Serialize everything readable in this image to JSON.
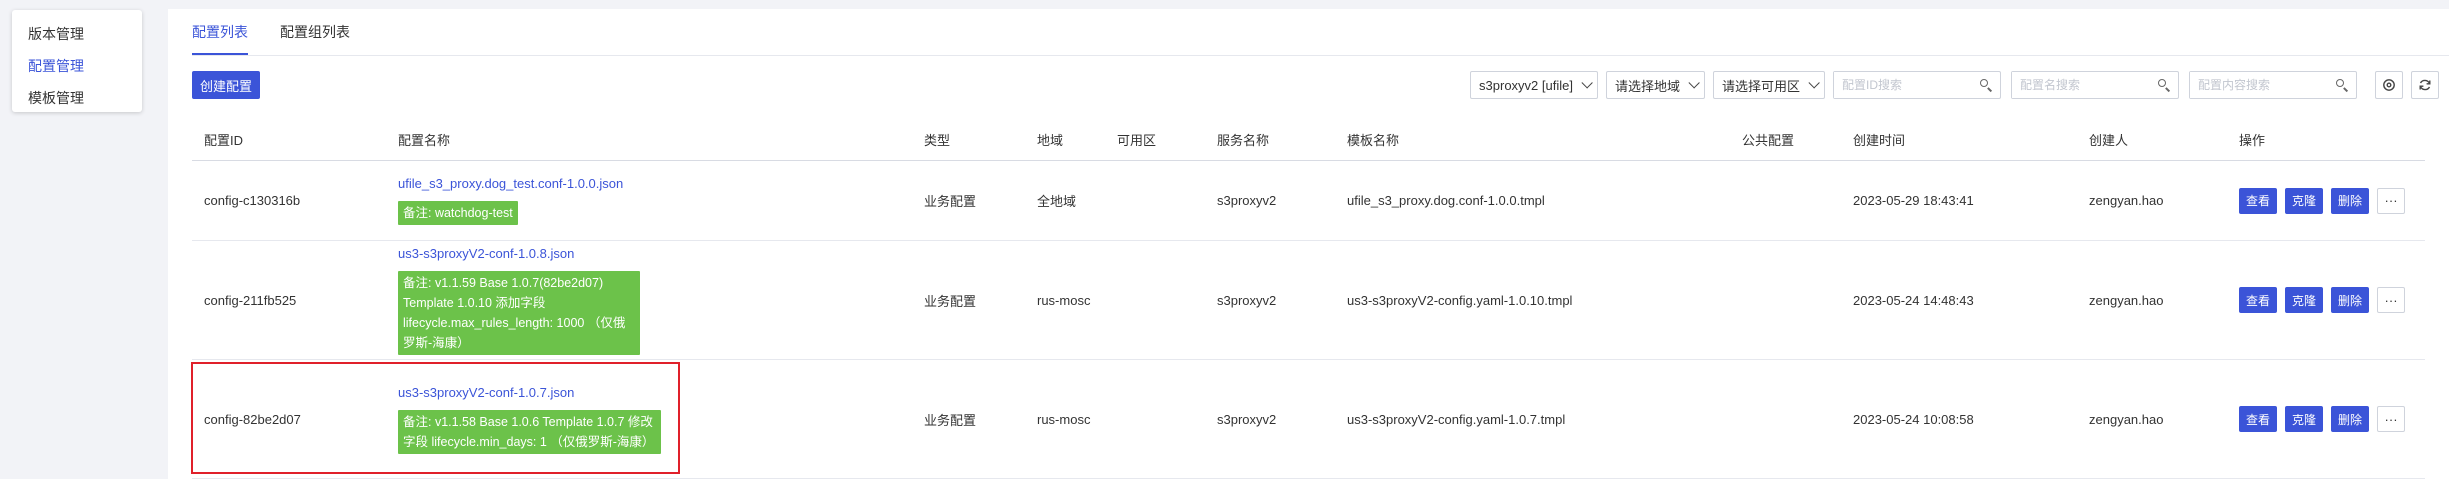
{
  "sidebar": {
    "items": [
      {
        "label": "版本管理",
        "active": false
      },
      {
        "label": "配置管理",
        "active": true
      },
      {
        "label": "模板管理",
        "active": false
      }
    ]
  },
  "tabs": [
    {
      "label": "配置列表",
      "active": true
    },
    {
      "label": "配置组列表",
      "active": false
    }
  ],
  "toolbar": {
    "create_label": "创建配置",
    "service_select": "s3proxyv2 [ufile]",
    "region_select": "请选择地域",
    "zone_select": "请选择可用区",
    "search_id_placeholder": "配置ID搜索",
    "search_name_placeholder": "配置名搜索",
    "search_content_placeholder": "配置内容搜索"
  },
  "table": {
    "headers": {
      "id": "配置ID",
      "name": "配置名称",
      "type": "类型",
      "region": "地域",
      "zone": "可用区",
      "service": "服务名称",
      "template": "模板名称",
      "public": "公共配置",
      "created": "创建时间",
      "creator": "创建人",
      "ops": "操作"
    },
    "rows": [
      {
        "id": "config-c130316b",
        "name": "ufile_s3_proxy.dog_test.conf-1.0.0.json",
        "note": "备注: watchdog-test",
        "type": "业务配置",
        "region": "全地域",
        "zone": "",
        "service": "s3proxyv2",
        "template": "ufile_s3_proxy.dog.conf-1.0.0.tmpl",
        "public": "",
        "created": "2023-05-29 18:43:41",
        "creator": "zengyan.hao"
      },
      {
        "id": "config-211fb525",
        "name": "us3-s3proxyV2-conf-1.0.8.json",
        "note": "备注: v1.1.59 Base 1.0.7(82be2d07) Template 1.0.10 添加字段 lifecycle.max_rules_length: 1000 （仅俄罗斯-海康）",
        "type": "业务配置",
        "region": "rus-mosc",
        "zone": "",
        "service": "s3proxyv2",
        "template": "us3-s3proxyV2-config.yaml-1.0.10.tmpl",
        "public": "",
        "created": "2023-05-24 14:48:43",
        "creator": "zengyan.hao"
      },
      {
        "id": "config-82be2d07",
        "name": "us3-s3proxyV2-conf-1.0.7.json",
        "note": "备注: v1.1.58 Base 1.0.6 Template 1.0.7 修改字段 lifecycle.min_days: 1 （仅俄罗斯-海康）",
        "type": "业务配置",
        "region": "rus-mosc",
        "zone": "",
        "service": "s3proxyv2",
        "template": "us3-s3proxyV2-config.yaml-1.0.7.tmpl",
        "public": "",
        "created": "2023-05-24 10:08:58",
        "creator": "zengyan.hao"
      }
    ],
    "actions": {
      "view": "查看",
      "clone": "克隆",
      "delete": "删除",
      "more": "···"
    }
  },
  "colors": {
    "primary": "#3b54d8",
    "note_bg": "#6cc24a",
    "highlight": "#e0202a"
  }
}
